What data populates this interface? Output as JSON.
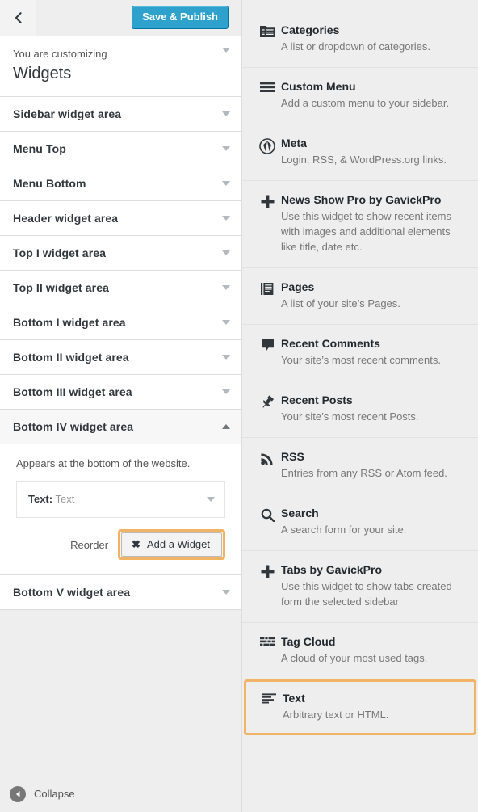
{
  "customizer": {
    "back_icon": "chevron-left-icon",
    "save_label": "Save & Publish",
    "accent_color": "#2ea2cc",
    "highlight_color": "#f0b464",
    "info": {
      "subtitle": "You are customizing",
      "title": "Widgets"
    },
    "sections": [
      {
        "label": "Sidebar widget area",
        "state": "collapsed"
      },
      {
        "label": "Menu Top",
        "state": "collapsed"
      },
      {
        "label": "Menu Bottom",
        "state": "collapsed"
      },
      {
        "label": "Header widget area",
        "state": "collapsed"
      },
      {
        "label": "Top I widget area",
        "state": "collapsed"
      },
      {
        "label": "Top II widget area",
        "state": "collapsed"
      },
      {
        "label": "Bottom I widget area",
        "state": "collapsed"
      },
      {
        "label": "Bottom II widget area",
        "state": "collapsed"
      },
      {
        "label": "Bottom III widget area",
        "state": "collapsed"
      },
      {
        "label": "Bottom IV widget area",
        "state": "expanded"
      },
      {
        "label": "Bottom V widget area",
        "state": "collapsed"
      }
    ],
    "expanded_section": {
      "label": "Bottom IV widget area",
      "description": "Appears at the bottom of the website.",
      "widget_chip": {
        "type_label": "Text:",
        "instance_label": "Text"
      },
      "reorder_label": "Reorder",
      "add_widget_label": "Add a Widget",
      "add_widget_icon": "close-x-icon"
    },
    "footer": {
      "collapse_label": "Collapse",
      "collapse_icon": "collapse-left-icon"
    }
  },
  "widget_panel": {
    "widgets": [
      {
        "name": "Categories",
        "description": "A list or dropdown of categories.",
        "icon": "categories-folder-icon",
        "highlighted": false
      },
      {
        "name": "Custom Menu",
        "description": "Add a custom menu to your sidebar.",
        "icon": "menu-lines-icon",
        "highlighted": false
      },
      {
        "name": "Meta",
        "description": "Login, RSS, & WordPress.org links.",
        "icon": "wordpress-logo-icon",
        "highlighted": false
      },
      {
        "name": "News Show Pro by GavickPro",
        "description": "Use this widget to show recent items with images and additional elements like title, date etc.",
        "icon": "plus-icon",
        "highlighted": false
      },
      {
        "name": "Pages",
        "description": "A list of your site’s Pages.",
        "icon": "pages-icon",
        "highlighted": false
      },
      {
        "name": "Recent Comments",
        "description": "Your site’s most recent comments.",
        "icon": "comment-bubble-icon",
        "highlighted": false
      },
      {
        "name": "Recent Posts",
        "description": "Your site’s most recent Posts.",
        "icon": "pushpin-icon",
        "highlighted": false
      },
      {
        "name": "RSS",
        "description": "Entries from any RSS or Atom feed.",
        "icon": "rss-icon",
        "highlighted": false
      },
      {
        "name": "Search",
        "description": "A search form for your site.",
        "icon": "search-icon",
        "highlighted": false
      },
      {
        "name": "Tabs by GavickPro",
        "description": "Use this widget to show tabs created form the selected sidebar",
        "icon": "plus-icon",
        "highlighted": false
      },
      {
        "name": "Tag Cloud",
        "description": "A cloud of your most used tags.",
        "icon": "tag-cloud-icon",
        "highlighted": false
      },
      {
        "name": "Text",
        "description": "Arbitrary text or HTML.",
        "icon": "text-lines-icon",
        "highlighted": true
      }
    ]
  }
}
